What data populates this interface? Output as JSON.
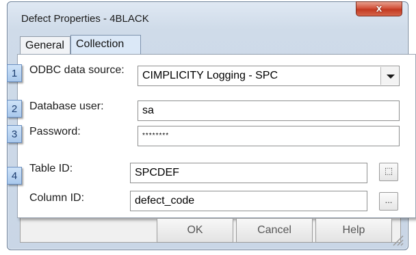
{
  "window": {
    "title": "Defect Properties - 4BLACK",
    "close_glyph": "x"
  },
  "tabs": [
    {
      "label": "General",
      "selected": false
    },
    {
      "label": "Collection",
      "selected": true
    }
  ],
  "form": {
    "odbc": {
      "step": "1",
      "label": "ODBC data source:",
      "value": "CIMPLICITY Logging - SPC"
    },
    "db_user": {
      "step": "2",
      "label": "Database user:",
      "value": "sa"
    },
    "password": {
      "step": "3",
      "label": "Password:",
      "value": "********"
    },
    "table_id": {
      "step": "4",
      "label": "Table ID:",
      "value": "SPCDEF",
      "button": "⬚"
    },
    "column_id": {
      "label": "Column ID:",
      "value": "defect_code",
      "button": "..."
    }
  },
  "buttons": {
    "ok": "OK",
    "cancel": "Cancel",
    "help": "Help"
  },
  "colors": {
    "step_badge": "#a9c8ec",
    "close_button": "#c23a22",
    "selected_tab": "#dbe8f7"
  }
}
